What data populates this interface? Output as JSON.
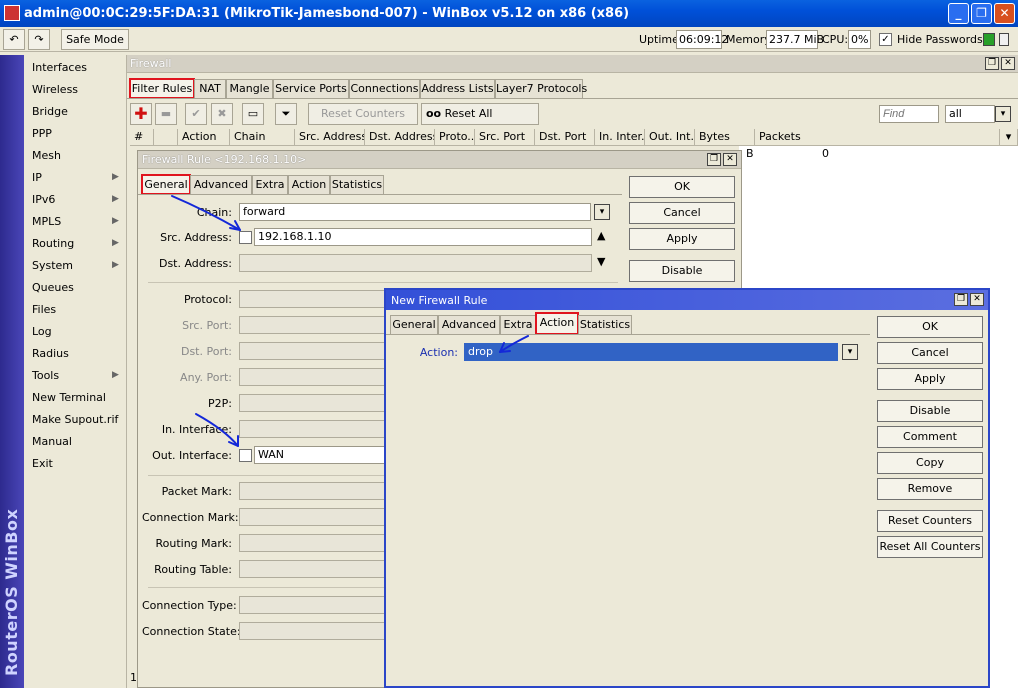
{
  "window": {
    "title": "admin@00:0C:29:5F:DA:31 (MikroTik-Jamesbond-007) - WinBox v5.12 on x86 (x86)",
    "min": "_",
    "max": "❐",
    "close": "✕"
  },
  "toolbar": {
    "undo": "↶",
    "redo": "↷",
    "safe_mode": "Safe Mode",
    "uptime_label": "Uptime:",
    "uptime": "06:09:12",
    "memory_label": "Memory:",
    "memory": "237.7 MiB",
    "cpu_label": "CPU:",
    "cpu": "0%",
    "hide_passwords": "Hide Passwords",
    "hide_passwords_checked": "✓"
  },
  "sidebar_brand": "RouterOS WinBox",
  "menu": [
    {
      "label": "Interfaces",
      "sub": ""
    },
    {
      "label": "Wireless",
      "sub": ""
    },
    {
      "label": "Bridge",
      "sub": ""
    },
    {
      "label": "PPP",
      "sub": ""
    },
    {
      "label": "Mesh",
      "sub": ""
    },
    {
      "label": "IP",
      "sub": "▶"
    },
    {
      "label": "IPv6",
      "sub": "▶"
    },
    {
      "label": "MPLS",
      "sub": "▶"
    },
    {
      "label": "Routing",
      "sub": "▶"
    },
    {
      "label": "System",
      "sub": "▶"
    },
    {
      "label": "Queues",
      "sub": ""
    },
    {
      "label": "Files",
      "sub": ""
    },
    {
      "label": "Log",
      "sub": ""
    },
    {
      "label": "Radius",
      "sub": ""
    },
    {
      "label": "Tools",
      "sub": "▶"
    },
    {
      "label": "New Terminal",
      "sub": ""
    },
    {
      "label": "Make Supout.rif",
      "sub": ""
    },
    {
      "label": "Manual",
      "sub": ""
    },
    {
      "label": "Exit",
      "sub": ""
    }
  ],
  "firewall": {
    "title": "Firewall",
    "tabs": [
      "Filter Rules",
      "NAT",
      "Mangle",
      "Service Ports",
      "Connections",
      "Address Lists",
      "Layer7 Protocols"
    ],
    "reset_counters": "Reset Counters",
    "reset_all_counters": "Reset All Counters",
    "oo": "oo",
    "find_placeholder": "Find",
    "filter_value": "all",
    "columns": [
      "#",
      "Action",
      "Chain",
      "Src. Address",
      "Dst. Address",
      "Proto...",
      "Src. Port",
      "Dst. Port",
      "In. Inter...",
      "Out. Int...",
      "Bytes",
      "Packets"
    ],
    "row": {
      "bytes": "B",
      "packets": "0"
    },
    "status_count": "1"
  },
  "rule_dialog": {
    "title": "Firewall Rule <192.168.1.10>",
    "tabs": [
      "General",
      "Advanced",
      "Extra",
      "Action",
      "Statistics"
    ],
    "fields": {
      "chain_label": "Chain:",
      "chain": "forward",
      "src_label": "Src. Address:",
      "src": "192.168.1.10",
      "dst_label": "Dst. Address:",
      "protocol_label": "Protocol:",
      "src_port_label": "Src. Port:",
      "dst_port_label": "Dst. Port:",
      "any_port_label": "Any. Port:",
      "p2p_label": "P2P:",
      "in_if_label": "In. Interface:",
      "out_if_label": "Out. Interface:",
      "out_if": "WAN",
      "packet_mark_label": "Packet Mark:",
      "conn_mark_label": "Connection Mark:",
      "routing_mark_label": "Routing Mark:",
      "routing_table_label": "Routing Table:",
      "conn_type_label": "Connection Type:",
      "conn_state_label": "Connection State:"
    },
    "buttons": [
      "OK",
      "Cancel",
      "Apply",
      "Disable"
    ]
  },
  "new_dialog": {
    "title": "New Firewall Rule",
    "tabs": [
      "General",
      "Advanced",
      "Extra",
      "Action",
      "Statistics"
    ],
    "action_label": "Action:",
    "action_value": "drop",
    "buttons": [
      "OK",
      "Cancel",
      "Apply",
      "Disable",
      "Comment",
      "Copy",
      "Remove",
      "Reset Counters",
      "Reset All Counters"
    ]
  },
  "colors": {
    "highlight": "#e0141e",
    "arrow": "#1428d8",
    "selection": "#3163c5",
    "titlebar": "#0050d8"
  }
}
